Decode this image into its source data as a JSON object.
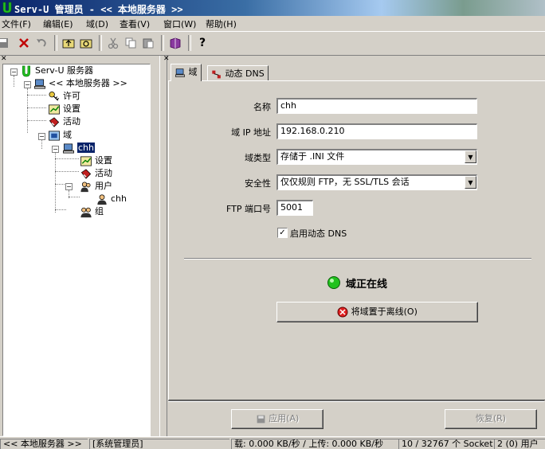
{
  "window": {
    "title": "Serv-U 管理员 - << 本地服务器 >>"
  },
  "menu": [
    "文件(F)",
    "编辑(E)",
    "域(D)",
    "查看(V)",
    "窗口(W)",
    "帮助(H)"
  ],
  "tree": {
    "root": "Serv-U 服务器",
    "server": "<< 本地服务器 >>",
    "license": "许可",
    "settings": "设置",
    "activity": "活动",
    "domains": "域",
    "domain_name": "chh",
    "domain_settings": "设置",
    "domain_activity": "活动",
    "users": "用户",
    "user_chh": "chh",
    "groups": "组"
  },
  "tabs": {
    "domain": "域",
    "dynamic_dns": "动态 DNS"
  },
  "form": {
    "name_label": "名称",
    "name_value": "chh",
    "ip_label": "域 IP 地址",
    "ip_value": "192.168.0.210",
    "type_label": "域类型",
    "type_value": "存储于 .INI 文件",
    "security_label": "安全性",
    "security_value": "仅仅规则 FTP，无 SSL/TLS 会话",
    "port_label": "FTP 端口号",
    "port_value": "5001",
    "dyndns_label": "启用动态 DNS",
    "dyndns_checked": "✓"
  },
  "status": {
    "online_text": "域正在线",
    "offline_button": "将域置于离线(O)"
  },
  "buttons": {
    "apply": "应用(A)",
    "restore": "恢复(R)"
  },
  "statusbar": {
    "server": "<< 本地服务器 >>",
    "role": "[系统管理员]",
    "transfer": "载: 0.000 KB/秒 / 上传: 0.000 KB/秒",
    "sockets": "10 / 32767 个 Socket",
    "users": "2 (0) 用户"
  },
  "colors": {
    "online": "#21c21e",
    "titlebar": "#0a246a",
    "selection": "#0a246a"
  }
}
